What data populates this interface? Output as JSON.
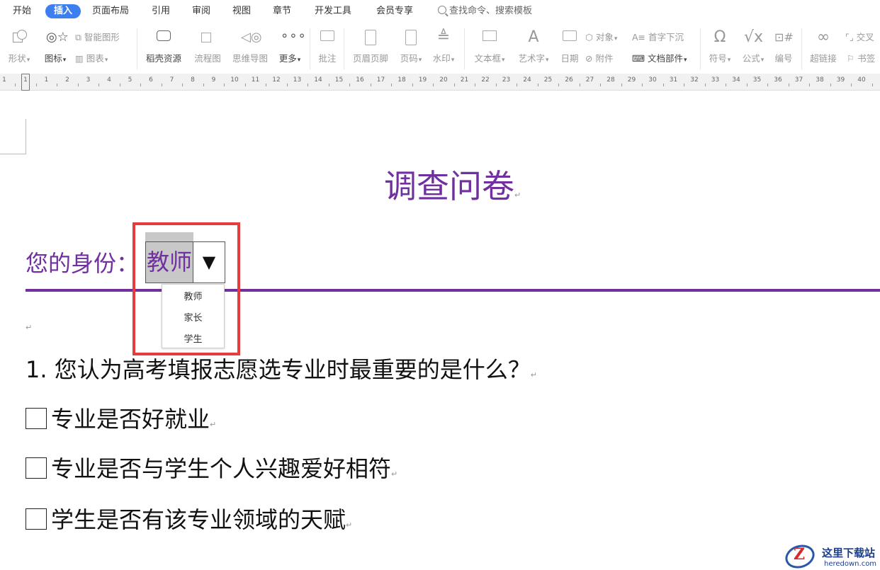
{
  "menu": {
    "tabs": [
      "开始",
      "插入",
      "页面布局",
      "引用",
      "审阅",
      "视图",
      "章节",
      "开发工具",
      "会员专享"
    ],
    "active_tab": "插入",
    "search_placeholder": "查找命令、搜索模板"
  },
  "toolbar": {
    "shape": "形状",
    "icon": "图标",
    "smart_art": "智能图形",
    "chart": "图表",
    "daoke": "稻壳资源",
    "flowchart": "流程图",
    "mindmap": "思维导图",
    "more": "更多",
    "comment": "批注",
    "header_footer": "页眉页脚",
    "page_number": "页码",
    "watermark": "水印",
    "textbox": "文本框",
    "wordart": "艺术字",
    "date": "日期",
    "object": "对象",
    "attachment": "附件",
    "dropcap": "首字下沉",
    "doc_parts": "文档部件",
    "symbol": "符号",
    "formula": "公式",
    "numbering": "编号",
    "hyperlink": "超链接",
    "crossref": "交叉",
    "bookmark": "书签"
  },
  "ruler": {
    "numbers": [
      "1",
      "1",
      "1",
      "2",
      "3",
      "4",
      "5",
      "6",
      "7",
      "8",
      "9",
      "10",
      "11",
      "12",
      "13",
      "14",
      "15",
      "16",
      "17",
      "18",
      "19",
      "20",
      "21",
      "22",
      "23",
      "24",
      "25",
      "26",
      "27",
      "28",
      "29",
      "30",
      "31",
      "32",
      "33",
      "34",
      "35",
      "36",
      "37",
      "38",
      "39",
      "40"
    ]
  },
  "document": {
    "title": "调查问卷",
    "identity_label": "您的身份：",
    "dropdown": {
      "selected": "教师",
      "arrow": "▼",
      "options": [
        "教师",
        "家长",
        "学生"
      ]
    },
    "question": "1. 您认为高考填报志愿选专业时最重要的是什么？",
    "options": [
      "专业是否好就业",
      "专业是否与学生个人兴趣爱好相符",
      "学生是否有该专业领域的天赋"
    ],
    "para_mark": "↵"
  },
  "watermark": {
    "logo": "Z",
    "cn": "这里下载站",
    "en": "heredown.com"
  },
  "colors": {
    "accent": "#7030a0",
    "highlight_box": "#e63c3c",
    "active_tab": "#3d7ff0"
  }
}
